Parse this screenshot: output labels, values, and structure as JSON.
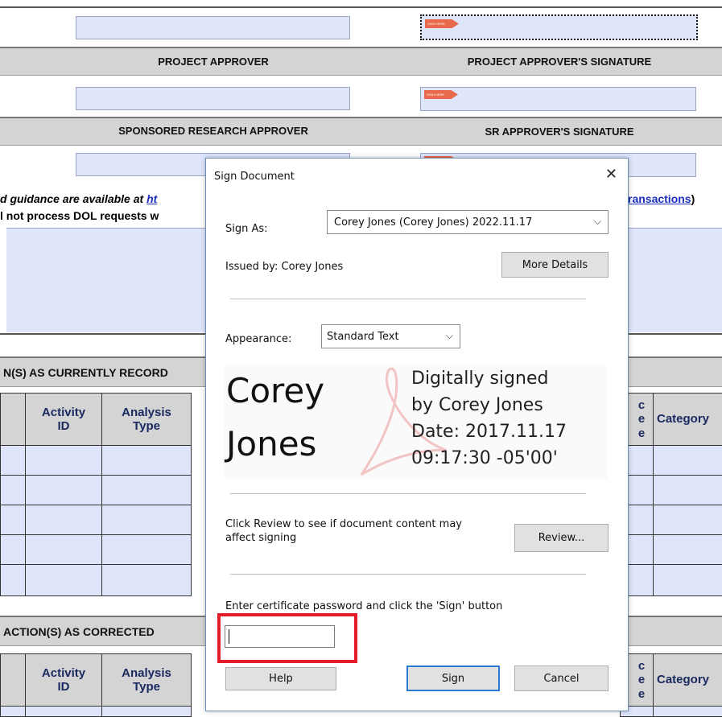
{
  "form": {
    "project_approver": "PROJECT APPROVER",
    "project_approver_signature": "PROJECT APPROVER'S SIGNATURE",
    "sr_approver": "SPONSORED RESEARCH APPROVER",
    "sr_approver_signature": "SR APPROVER'S SIGNATURE",
    "sign_tag": "SIGN HERE",
    "guidance_prefix": "d guidance are available at ",
    "guidance_link_start": "ht",
    "guidance_link_end": "ransactions",
    "guidance_suffix": ")",
    "dol_note": "l not process DOL requests w",
    "section_current": "N(S) AS CURRENTLY RECORD",
    "section_corrected": "ACTION(S) AS CORRECTED",
    "col_activity": "Activity ID",
    "col_analysis": "Analysis Type",
    "col_partial": "ce e",
    "col_category": "Category"
  },
  "dialog": {
    "title": "Sign Document",
    "close_glyph": "✕",
    "sign_as_label": "Sign As:",
    "sign_as_value": "Corey Jones (Corey Jones) 2022.11.17",
    "issued_by": "Issued by: Corey Jones",
    "more_details": "More Details",
    "appearance_label": "Appearance:",
    "appearance_value": "Standard Text",
    "preview_first": "Corey",
    "preview_last": "Jones",
    "preview_line1": "Digitally signed",
    "preview_line2": "by Corey Jones",
    "preview_line3": "Date: 2017.11.17",
    "preview_line4": "09:17:30 -05'00'",
    "review_text": "Click Review to see if document content may affect signing",
    "review_button": "Review...",
    "password_prompt": "Enter certificate password and click the 'Sign' button",
    "password_value": "",
    "help_button": "Help",
    "sign_button": "Sign",
    "cancel_button": "Cancel",
    "chevron_glyph": "⌵"
  },
  "colors": {
    "field_fill": "#dfe5fb",
    "header_band": "#d4d4d4",
    "highlight": "#e31b2a",
    "primary_border": "#2a7bd4"
  }
}
